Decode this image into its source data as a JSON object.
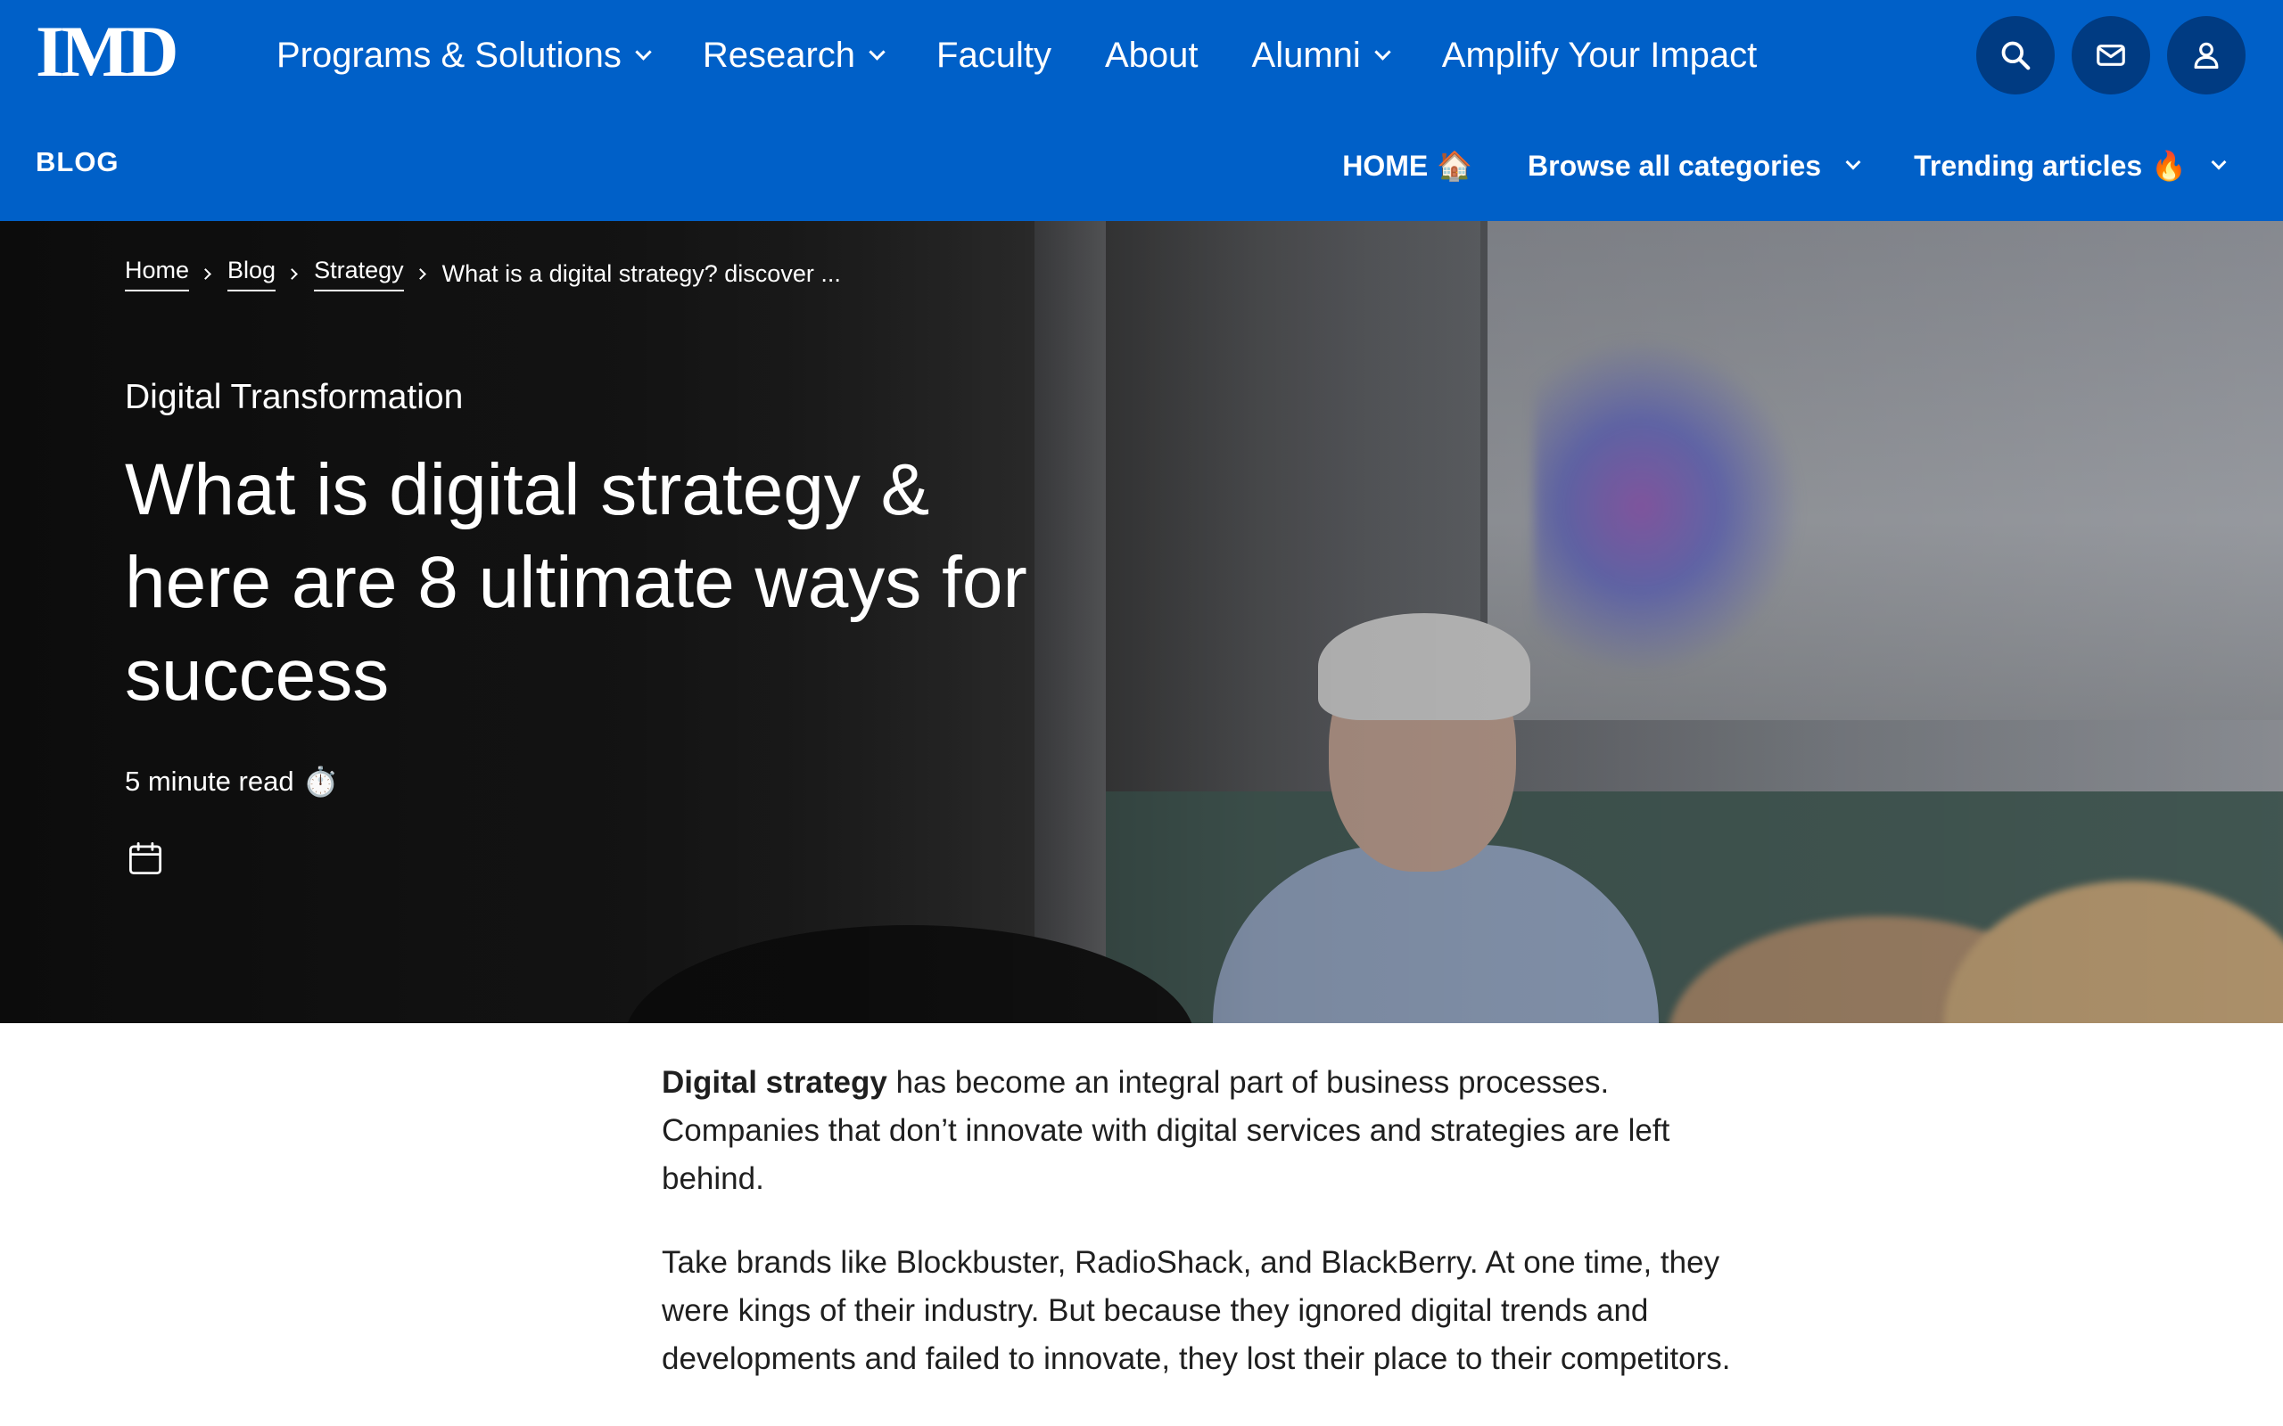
{
  "header": {
    "logo_text": "IMD",
    "nav": [
      {
        "label": "Programs & Solutions",
        "has_dropdown": true
      },
      {
        "label": "Research",
        "has_dropdown": true
      },
      {
        "label": "Faculty",
        "has_dropdown": false
      },
      {
        "label": "About",
        "has_dropdown": false
      },
      {
        "label": "Alumni",
        "has_dropdown": true
      },
      {
        "label": "Amplify Your Impact",
        "has_dropdown": false
      }
    ],
    "icons": [
      "search-icon",
      "mail-icon",
      "user-icon"
    ],
    "brand_color": "#0060c8",
    "icon_button_color": "#003b82"
  },
  "subnav": {
    "section_label": "BLOG",
    "items": [
      {
        "label": "HOME",
        "emoji": "🏠",
        "has_dropdown": false
      },
      {
        "label": "Browse all categories",
        "emoji": "",
        "has_dropdown": true
      },
      {
        "label": "Trending articles",
        "emoji": "🔥",
        "has_dropdown": true
      }
    ]
  },
  "hero": {
    "breadcrumb": [
      "Home",
      "Blog",
      "Strategy"
    ],
    "breadcrumb_current": "What is a digital strategy? discover ...",
    "category": "Digital Transformation",
    "title": "What is digital strategy & here are 8 ultimate ways for success",
    "read_time": "5 minute read",
    "read_time_emoji": "⏱️",
    "date_icon": "calendar-icon"
  },
  "article": {
    "intro_bold": "Digital strategy",
    "intro_rest": " has become an integral part of business processes. Companies that don’t innovate with digital services and strategies are left behind.",
    "paragraph_2": "Take brands like Blockbuster, RadioShack, and BlackBerry. At one time, they were kings of their industry. But because they ignored digital trends and developments and failed to innovate, they lost their place to their competitors."
  }
}
